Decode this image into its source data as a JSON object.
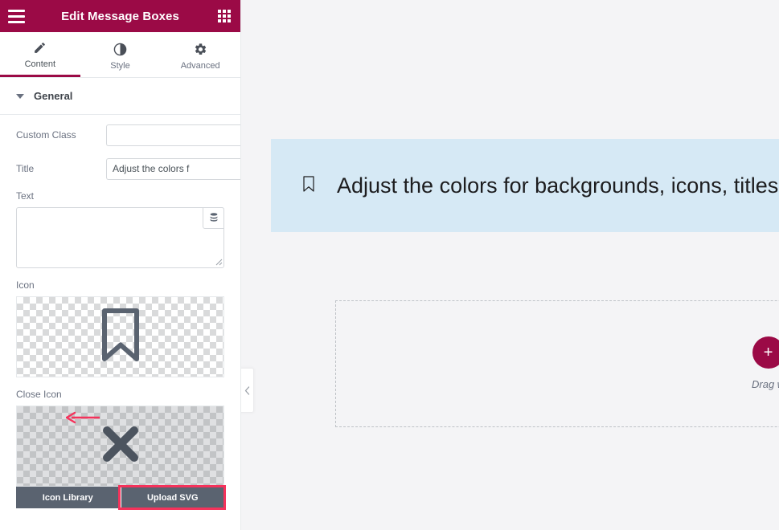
{
  "panel": {
    "header": {
      "title": "Edit Message Boxes",
      "menu_icon": "hamburger-menu-icon",
      "grid_icon": "widgets-grid-icon"
    },
    "tabs": [
      {
        "label": "Content",
        "icon": "pencil-icon",
        "active": true
      },
      {
        "label": "Style",
        "icon": "contrast-circle-icon",
        "active": false
      },
      {
        "label": "Advanced",
        "icon": "gear-icon",
        "active": false
      }
    ],
    "section": {
      "title": "General",
      "caret_icon": "caret-down-icon"
    },
    "fields": {
      "custom_class": {
        "label": "Custom Class",
        "value": "",
        "placeholder": "",
        "dynamic_icon": "dynamic-tag-icon"
      },
      "title": {
        "label": "Title",
        "value": "Adjust the colors f",
        "placeholder": "",
        "dynamic_icon": "dynamic-tag-icon"
      },
      "text": {
        "label": "Text",
        "value": "",
        "placeholder": "",
        "dynamic_icon": "dynamic-tag-icon",
        "resize_handle": "resize-handle-icon"
      }
    },
    "icon_control": {
      "label": "Icon",
      "preview_icon": "bookmark-icon"
    },
    "close_icon_control": {
      "label": "Close Icon",
      "preview_icon": "close-x-icon",
      "annotation_icon": "left-arrow-annotation-icon",
      "buttons": [
        {
          "label": "Icon Library",
          "highlighted": false
        },
        {
          "label": "Upload SVG",
          "highlighted": true
        }
      ]
    }
  },
  "canvas": {
    "collapse_handle_icon": "chevron-left-icon",
    "message_box": {
      "icon": "bookmark-icon",
      "title": "Adjust the colors for backgrounds, icons, titles",
      "background_color": "#d6e9f5"
    },
    "dropzone": {
      "add_icon": "plus-icon",
      "hint": "Drag w"
    }
  },
  "colors": {
    "brand": "#9b0a46",
    "highlight": "#f5325b",
    "panel_bg": "#ffffff",
    "canvas_bg": "#f4f4f6",
    "icon_gray": "#5a6370"
  }
}
